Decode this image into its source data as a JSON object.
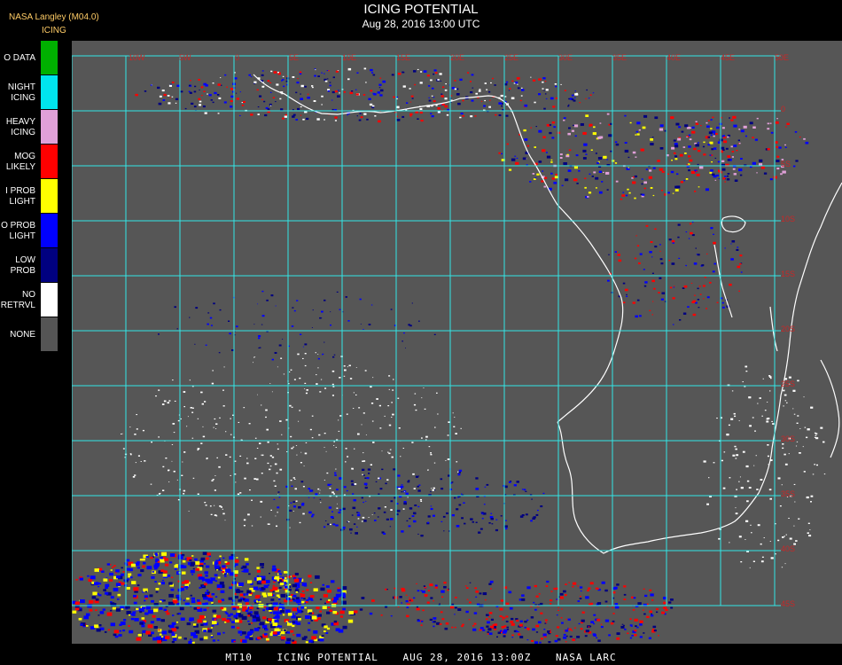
{
  "header": {
    "source": "NASA Langley (M04.0)",
    "product": "ICING",
    "title": "ICING POTENTIAL",
    "datetime": "Aug 28, 2016 13:00 UTC"
  },
  "legend": [
    {
      "label": "O DATA",
      "color": "#00b000"
    },
    {
      "label": "NIGHT\nICING",
      "color": "#00e5ee"
    },
    {
      "label": "HEAVY\nICING",
      "color": "#e0a0d8"
    },
    {
      "label": "MOG\nLIKELY",
      "color": "#ff0000"
    },
    {
      "label": "I PROB\nLIGHT",
      "color": "#ffff00"
    },
    {
      "label": "O PROB\nLIGHT",
      "color": "#0000ff"
    },
    {
      "label": "LOW\nPROB",
      "color": "#000080"
    },
    {
      "label": "NO\nRETRVL",
      "color": "#ffffff"
    },
    {
      "label": "NONE",
      "color": "#555555"
    }
  ],
  "map": {
    "background": "#565656",
    "grid_color": "#33e6e6",
    "coast_color": "#ffffff",
    "top_labels": [
      "10W",
      "5W",
      "0",
      "5E",
      "10E",
      "15E",
      "20E",
      "25E",
      "30E",
      "35E",
      "40E",
      "45E",
      "50E"
    ],
    "right_labels": [
      "0",
      "5S",
      "10S",
      "15S",
      "20S",
      "25S",
      "30S",
      "35S",
      "40S",
      "45S"
    ]
  },
  "footer": {
    "product_code": "MT10",
    "product_name": "ICING POTENTIAL",
    "date": "AUG 28, 2016 13:00Z",
    "agency": "NASA LARC"
  }
}
